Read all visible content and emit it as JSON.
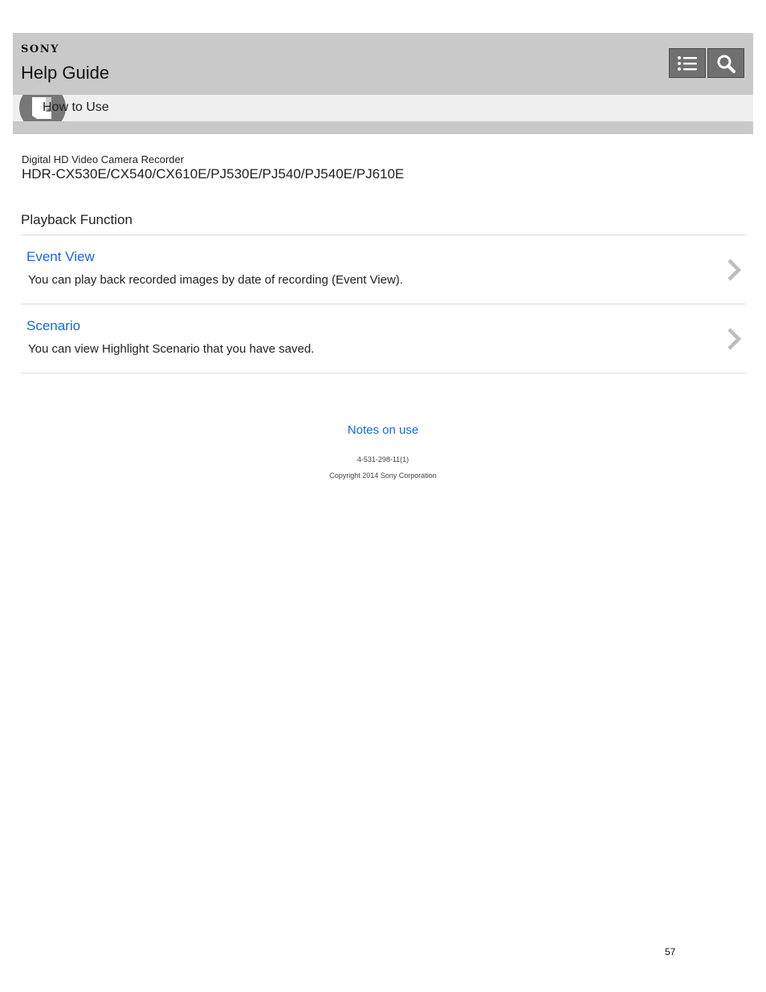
{
  "header": {
    "brand": "SONY",
    "title": "Help Guide",
    "toc_icon": "list-icon",
    "search_icon": "search-icon",
    "background": "#c9c9c9",
    "button_color": "#707070"
  },
  "breadcrumb": {
    "label": "How to Use",
    "icon": "book-icon"
  },
  "product": {
    "category": "Digital HD Video Camera Recorder",
    "models": "HDR-CX530E/CX540/CX610E/PJ530E/PJ540/PJ540E/PJ610E"
  },
  "section": {
    "title": "Playback Function",
    "topics": [
      {
        "title": "Event View",
        "description": "You can play back recorded images by date of recording (Event View).",
        "icon": "chevron-right-icon"
      },
      {
        "title": "Scenario",
        "description": "You can view Highlight Scenario that you have saved.",
        "icon": "chevron-right-icon"
      }
    ]
  },
  "footer": {
    "notes_link": "Notes on use",
    "doc_id": "4-531-298-11(1)",
    "copyright": "Copyright 2014 Sony Corporation",
    "link_color": "#1a66d9"
  },
  "page_number": "57"
}
